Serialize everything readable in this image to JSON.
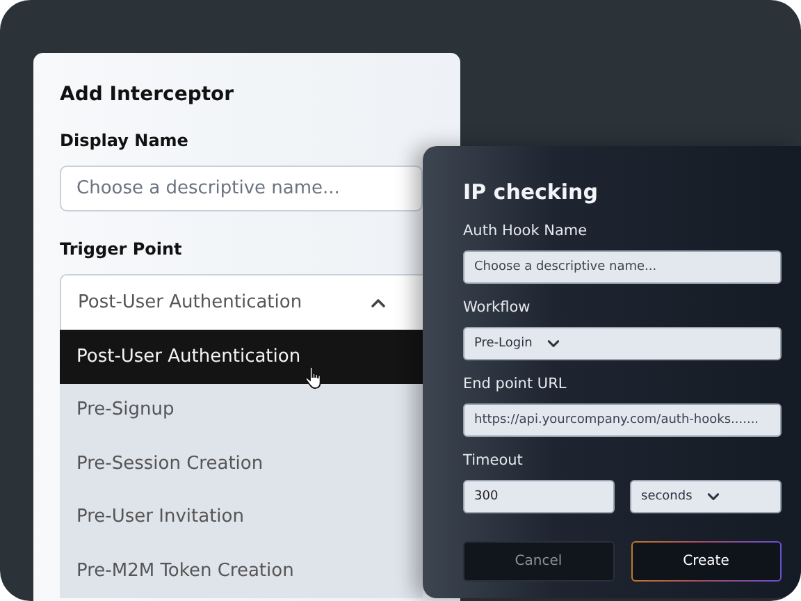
{
  "interceptor_form": {
    "title": "Add Interceptor",
    "display_name": {
      "label": "Display Name",
      "placeholder": "Choose a descriptive name..."
    },
    "trigger_point": {
      "label": "Trigger Point",
      "value": "Post-User Authentication",
      "expanded": true,
      "options": [
        {
          "label": "Post-User Authentication",
          "selected": true
        },
        {
          "label": "Pre-Signup",
          "selected": false
        },
        {
          "label": "Pre-Session Creation",
          "selected": false
        },
        {
          "label": "Pre-User Invitation",
          "selected": false
        },
        {
          "label": "Pre-M2M Token Creation",
          "selected": false
        }
      ]
    }
  },
  "hook_form": {
    "title": "IP checking",
    "fields": [
      {
        "kind": "input",
        "label": "Auth Hook Name",
        "placeholder": "Choose a descriptive name..."
      },
      {
        "kind": "select",
        "label": "Workflow",
        "value": "Pre-Login"
      },
      {
        "kind": "input",
        "label": "End point URL",
        "placeholder": "https://api.yourcompany.com/auth-hooks......."
      },
      {
        "kind": "pair",
        "label": "Timeout",
        "value": "300",
        "unit": "seconds"
      }
    ],
    "buttons": [
      {
        "label": "Cancel",
        "kind": "secondary"
      },
      {
        "label": "Create",
        "kind": "primary"
      }
    ]
  }
}
